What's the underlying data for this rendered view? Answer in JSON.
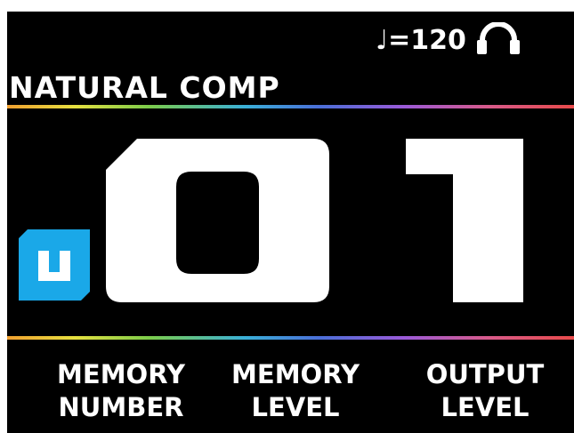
{
  "header": {
    "tempo_text": "♩=120",
    "patch_name": "NATURAL COMP"
  },
  "memory": {
    "number": "01",
    "badge_letter": "U"
  },
  "footer": {
    "labels": [
      {
        "line1": "MEMORY",
        "line2": "NUMBER"
      },
      {
        "line1": "MEMORY",
        "line2": "LEVEL"
      },
      {
        "line1": "OUTPUT",
        "line2": "LEVEL"
      }
    ]
  },
  "colors": {
    "background": "#000000",
    "text": "#ffffff",
    "badge": "#1aa8e8"
  },
  "icons": {
    "headphones": "headphones-icon",
    "user_badge": "user-memory-icon"
  }
}
